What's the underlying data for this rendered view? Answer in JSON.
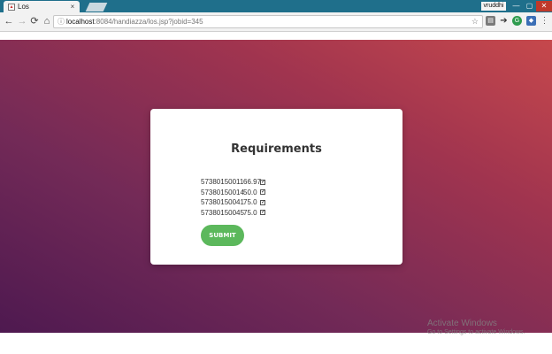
{
  "browser": {
    "tab_title": "Los",
    "tab_close": "×",
    "user_name": "vruddhi",
    "window_controls": {
      "minimize": "—",
      "maximize": "▢",
      "close": "✕"
    },
    "nav": {
      "back": "←",
      "forward": "→",
      "reload": "⟳",
      "home": "⌂"
    },
    "url_host": "localhost",
    "url_path": ":8084/handiazza/los.jsp?jobid=345",
    "extensions": [
      "extension-icon",
      "arrow-icon",
      "grammarly-icon",
      "shield-icon",
      "menu-icon"
    ]
  },
  "card": {
    "title": "Requirements",
    "requirements": [
      {
        "id": "57380150011",
        "score": "66.97",
        "checked": true
      },
      {
        "id": "57380150014",
        "score": "50.0",
        "checked": true
      },
      {
        "id": "57380150041",
        "score": "75.0",
        "checked": true
      },
      {
        "id": "57380150045",
        "score": "75.0",
        "checked": true
      }
    ],
    "submit_label": "SUBMIT"
  },
  "watermark": {
    "title": "Activate Windows",
    "subtitle": "Go to Settings to activate Windows."
  },
  "colors": {
    "gradient_start": "#4e1950",
    "gradient_end": "#c6484c",
    "submit": "#5cb85c",
    "tabbar": "#1f6f8b"
  }
}
